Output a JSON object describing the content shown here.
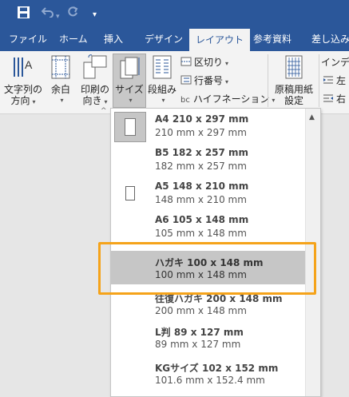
{
  "qat": {
    "save_icon": "save-icon",
    "undo_icon": "undo-icon",
    "redo_icon": "redo-icon",
    "customize_glyph": "▾"
  },
  "tabs": [
    {
      "label": "ファイル",
      "active": false
    },
    {
      "label": "ホーム",
      "active": false
    },
    {
      "label": "挿入",
      "active": false
    },
    {
      "label": "デザイン",
      "active": false
    },
    {
      "label": "レイアウト",
      "active": true
    },
    {
      "label": "参考資料",
      "active": false
    },
    {
      "label": "差し込み",
      "active": false
    }
  ],
  "ribbon": {
    "text_direction": {
      "line1": "文字列の",
      "line2": "方向"
    },
    "margins": {
      "label": "余白"
    },
    "orientation": {
      "line1": "印刷の",
      "line2": "向き"
    },
    "size": {
      "label": "サイズ"
    },
    "columns": {
      "label": "段組み"
    },
    "breaks": {
      "label": "区切り"
    },
    "line_numbers": {
      "label": "行番号"
    },
    "hyphenation": {
      "label": "ハイフネーション",
      "prefix": "bc"
    },
    "manuscript": {
      "line1": "原稿用紙",
      "line2": "設定"
    },
    "indent": {
      "label": "インデン",
      "left": "左",
      "right": "右"
    }
  },
  "size_menu": {
    "items": [
      {
        "title": "A4 210 x 297 mm",
        "sub": "210 mm x 297 mm",
        "icon": "page-a4-icon"
      },
      {
        "title": "B5 182 x 257 mm",
        "sub": "182 mm x 257 mm"
      },
      {
        "title": "A5 148 x 210 mm",
        "sub": "148 mm x 210 mm",
        "icon": "page-a5-icon"
      },
      {
        "title": "A6 105 x 148 mm",
        "sub": "105 mm x 148 mm"
      },
      {
        "title": "ハガキ 100 x 148 mm",
        "sub": "100 mm x 148 mm",
        "selected": true
      },
      {
        "title": "往復ハガキ 200 x 148 mm",
        "sub": "200 mm x 148 mm"
      },
      {
        "title": "L判 89 x 127 mm",
        "sub": "89 mm x 127 mm"
      },
      {
        "title": "KGサイズ 102 x 152 mm",
        "sub": "101.6 mm x 152.4 mm"
      }
    ]
  },
  "colors": {
    "accent": "#2b579a",
    "highlight": "#f5a31a",
    "selected": "#c6c6c6"
  }
}
